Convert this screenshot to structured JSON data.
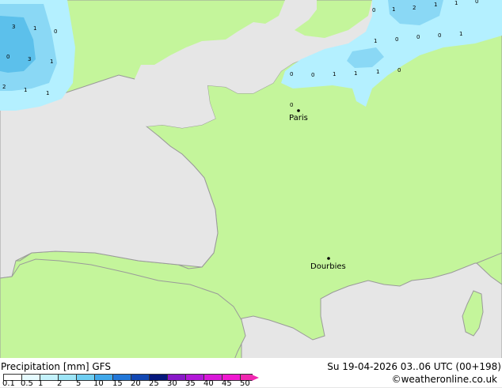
{
  "map": {
    "cities": [
      {
        "name": "Paris",
        "label": "Paris"
      },
      {
        "name": "Dourbies",
        "label": "Dourbies"
      }
    ],
    "precip_labels": [
      "3",
      "1",
      "0",
      "0",
      "3",
      "1",
      "2",
      "1",
      "1",
      "0",
      "1",
      "2",
      "1",
      "1",
      "0",
      "0",
      "1",
      "0",
      "0",
      "1",
      "0",
      "0",
      "1",
      "1",
      "1",
      "0",
      "0"
    ],
    "colors": {
      "land": "#c4f59b",
      "sea": "#e6e6e6",
      "coast": "#9a9a9a",
      "precip_light": "#b4f0ff",
      "precip_mid": "#8ad8f5",
      "precip_heavy": "#5cc0eb"
    }
  },
  "footer": {
    "title": "Precipitation [mm]  GFS",
    "datetime": "Su 19-04-2026 03..06 UTC (00+198)",
    "credit": "©weatheronline.co.uk",
    "scale_ticks": [
      "0.1",
      "0.5",
      "1",
      "2",
      "5",
      "10",
      "15",
      "20",
      "25",
      "30",
      "35",
      "40",
      "45",
      "50"
    ],
    "scale_colors": [
      "#ffffff",
      "#e6fbff",
      "#c4f2fc",
      "#9de5f7",
      "#6ecef2",
      "#40a8ea",
      "#2277d8",
      "#1248b3",
      "#06187d",
      "#8818c8",
      "#b218d8",
      "#d818d8",
      "#f018d0",
      "#f028b0"
    ]
  }
}
